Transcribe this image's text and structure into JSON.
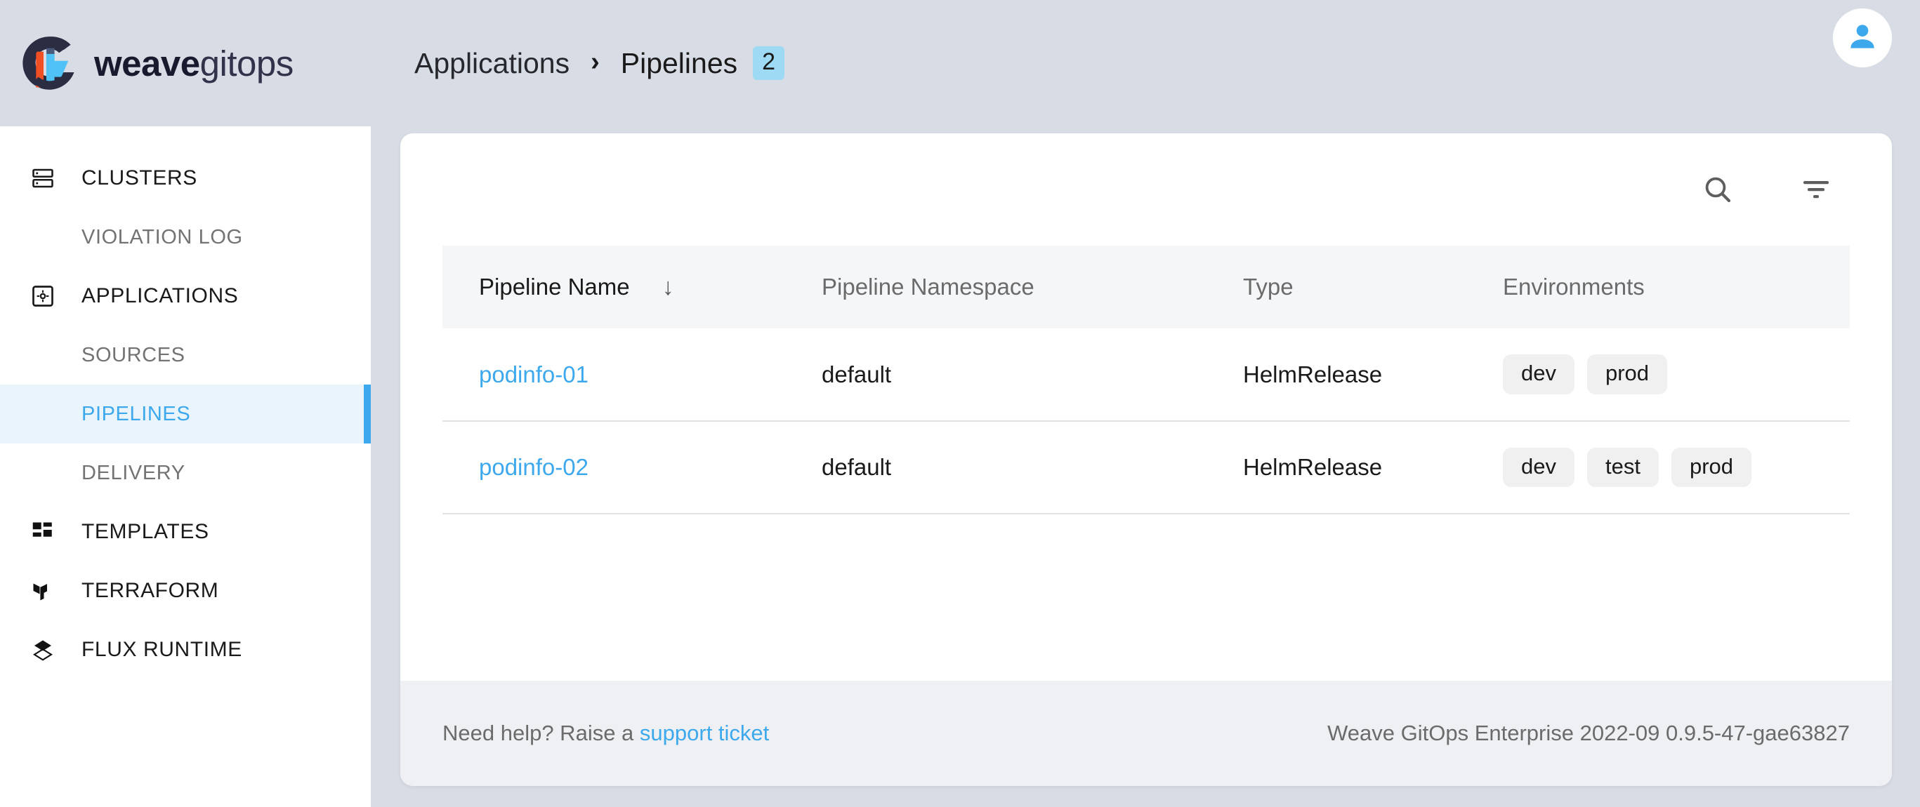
{
  "brand": {
    "name_bold": "weave",
    "name_light": "gitops",
    "logo_icon": "weave-gitops-logo",
    "colors": {
      "dark": "#2B2D42",
      "orange": "#F04E23",
      "cyan": "#4FC3F7"
    }
  },
  "header": {
    "breadcrumb": [
      {
        "label": "Applications",
        "current": false
      },
      {
        "label": "Pipelines",
        "current": true
      }
    ],
    "separator": "›",
    "count_badge": "2",
    "badge_color": "#9EDAF3",
    "avatar_icon": "account-circle-icon"
  },
  "sidebar": {
    "items": [
      {
        "label": "CLUSTERS",
        "icon": "clusters-icon",
        "sub": false,
        "active": false
      },
      {
        "label": "VIOLATION LOG",
        "icon": null,
        "sub": true,
        "active": false
      },
      {
        "label": "APPLICATIONS",
        "icon": "applications-icon",
        "sub": false,
        "active": false
      },
      {
        "label": "SOURCES",
        "icon": null,
        "sub": true,
        "active": false
      },
      {
        "label": "PIPELINES",
        "icon": null,
        "sub": true,
        "active": true
      },
      {
        "label": "DELIVERY",
        "icon": null,
        "sub": true,
        "active": false
      },
      {
        "label": "TEMPLATES",
        "icon": "templates-icon",
        "sub": false,
        "active": false
      },
      {
        "label": "TERRAFORM",
        "icon": "terraform-icon",
        "sub": false,
        "active": false
      },
      {
        "label": "FLUX RUNTIME",
        "icon": "flux-runtime-icon",
        "sub": false,
        "active": false
      }
    ],
    "active_color": "#3DA9EC",
    "active_bg": "#E9F4FC"
  },
  "toolbar": {
    "search_icon": "search-icon",
    "filter_icon": "filter-icon"
  },
  "table": {
    "columns": [
      {
        "key": "name",
        "label": "Pipeline Name",
        "sorted": true,
        "sort_arrow": "↓"
      },
      {
        "key": "ns",
        "label": "Pipeline Namespace",
        "sorted": false,
        "sort_arrow": ""
      },
      {
        "key": "type",
        "label": "Type",
        "sorted": false,
        "sort_arrow": ""
      },
      {
        "key": "env",
        "label": "Environments",
        "sorted": false,
        "sort_arrow": ""
      }
    ],
    "rows": [
      {
        "name": "podinfo-01",
        "ns": "default",
        "type": "HelmRelease",
        "env": [
          "dev",
          "prod"
        ]
      },
      {
        "name": "podinfo-02",
        "ns": "default",
        "type": "HelmRelease",
        "env": [
          "dev",
          "test",
          "prod"
        ]
      }
    ]
  },
  "footer": {
    "help_prefix": "Need help? Raise a ",
    "help_link": "support ticket",
    "version": "Weave GitOps Enterprise 2022-09 0.9.5-47-gae63827"
  }
}
